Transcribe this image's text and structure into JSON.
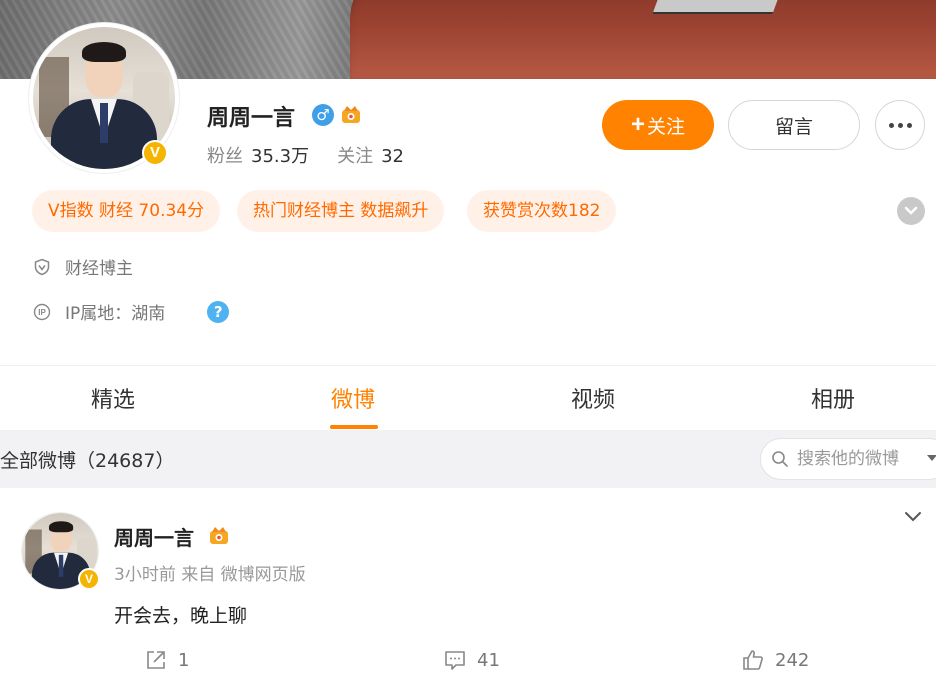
{
  "profile": {
    "name": "周周一言",
    "stats": {
      "fans_label": "粉丝",
      "fans_value": "35.3万",
      "follow_label": "关注",
      "follow_value": "32"
    },
    "verified_badge": "V",
    "gender_icon": "male-icon"
  },
  "actions": {
    "follow_label": "关注",
    "follow_plus": "+",
    "message_label": "留言"
  },
  "tags": [
    "V指数 财经 70.34分",
    "热门财经博主 数据飙升",
    "获赞赏次数182"
  ],
  "info": {
    "category": "财经博主",
    "ip_location": "IP属地：湖南",
    "help_glyph": "?"
  },
  "tabs": [
    "精选",
    "微博",
    "视频",
    "相册"
  ],
  "active_tab": "微博",
  "filter": {
    "title": "全部微博（24687）",
    "search_placeholder": "搜索他的微博"
  },
  "post": {
    "author": "周周一言",
    "meta": "3小时前 来自 微博网页版",
    "text": "开会去，晚上聊",
    "repost_count": "1",
    "comment_count": "41",
    "like_count": "242"
  },
  "colors": {
    "accent": "#ff8200",
    "tag_text": "#ff6a00",
    "tag_bg": "#fff1e8",
    "verified": "#f4b400"
  }
}
